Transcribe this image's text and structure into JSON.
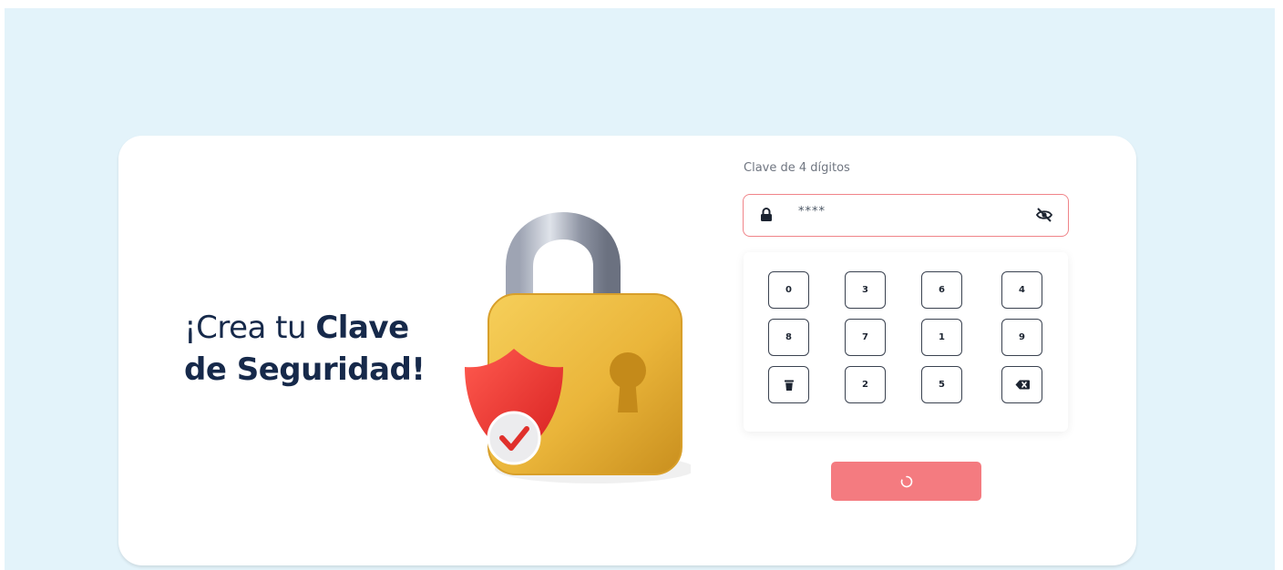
{
  "headline": {
    "prefix": "¡Crea tu ",
    "bold1": "Clave",
    "bold2": "de Seguridad!"
  },
  "pin_field": {
    "label": "Clave de 4 dígitos",
    "value": "****"
  },
  "keypad": {
    "rows": [
      [
        "0",
        "3",
        "6",
        "4"
      ],
      [
        "8",
        "7",
        "1",
        "9"
      ],
      [
        "",
        "2",
        "5",
        ""
      ]
    ]
  },
  "icons": {
    "field_left": "lock-icon",
    "field_right": "eye-slash-icon",
    "clear": "trash-icon",
    "backspace": "backspace-icon",
    "submit": "spinner-icon"
  },
  "colors": {
    "background": "#e3f3fa",
    "headline": "#16294a",
    "field_border": "#f08489",
    "submit": "#f47b80"
  }
}
